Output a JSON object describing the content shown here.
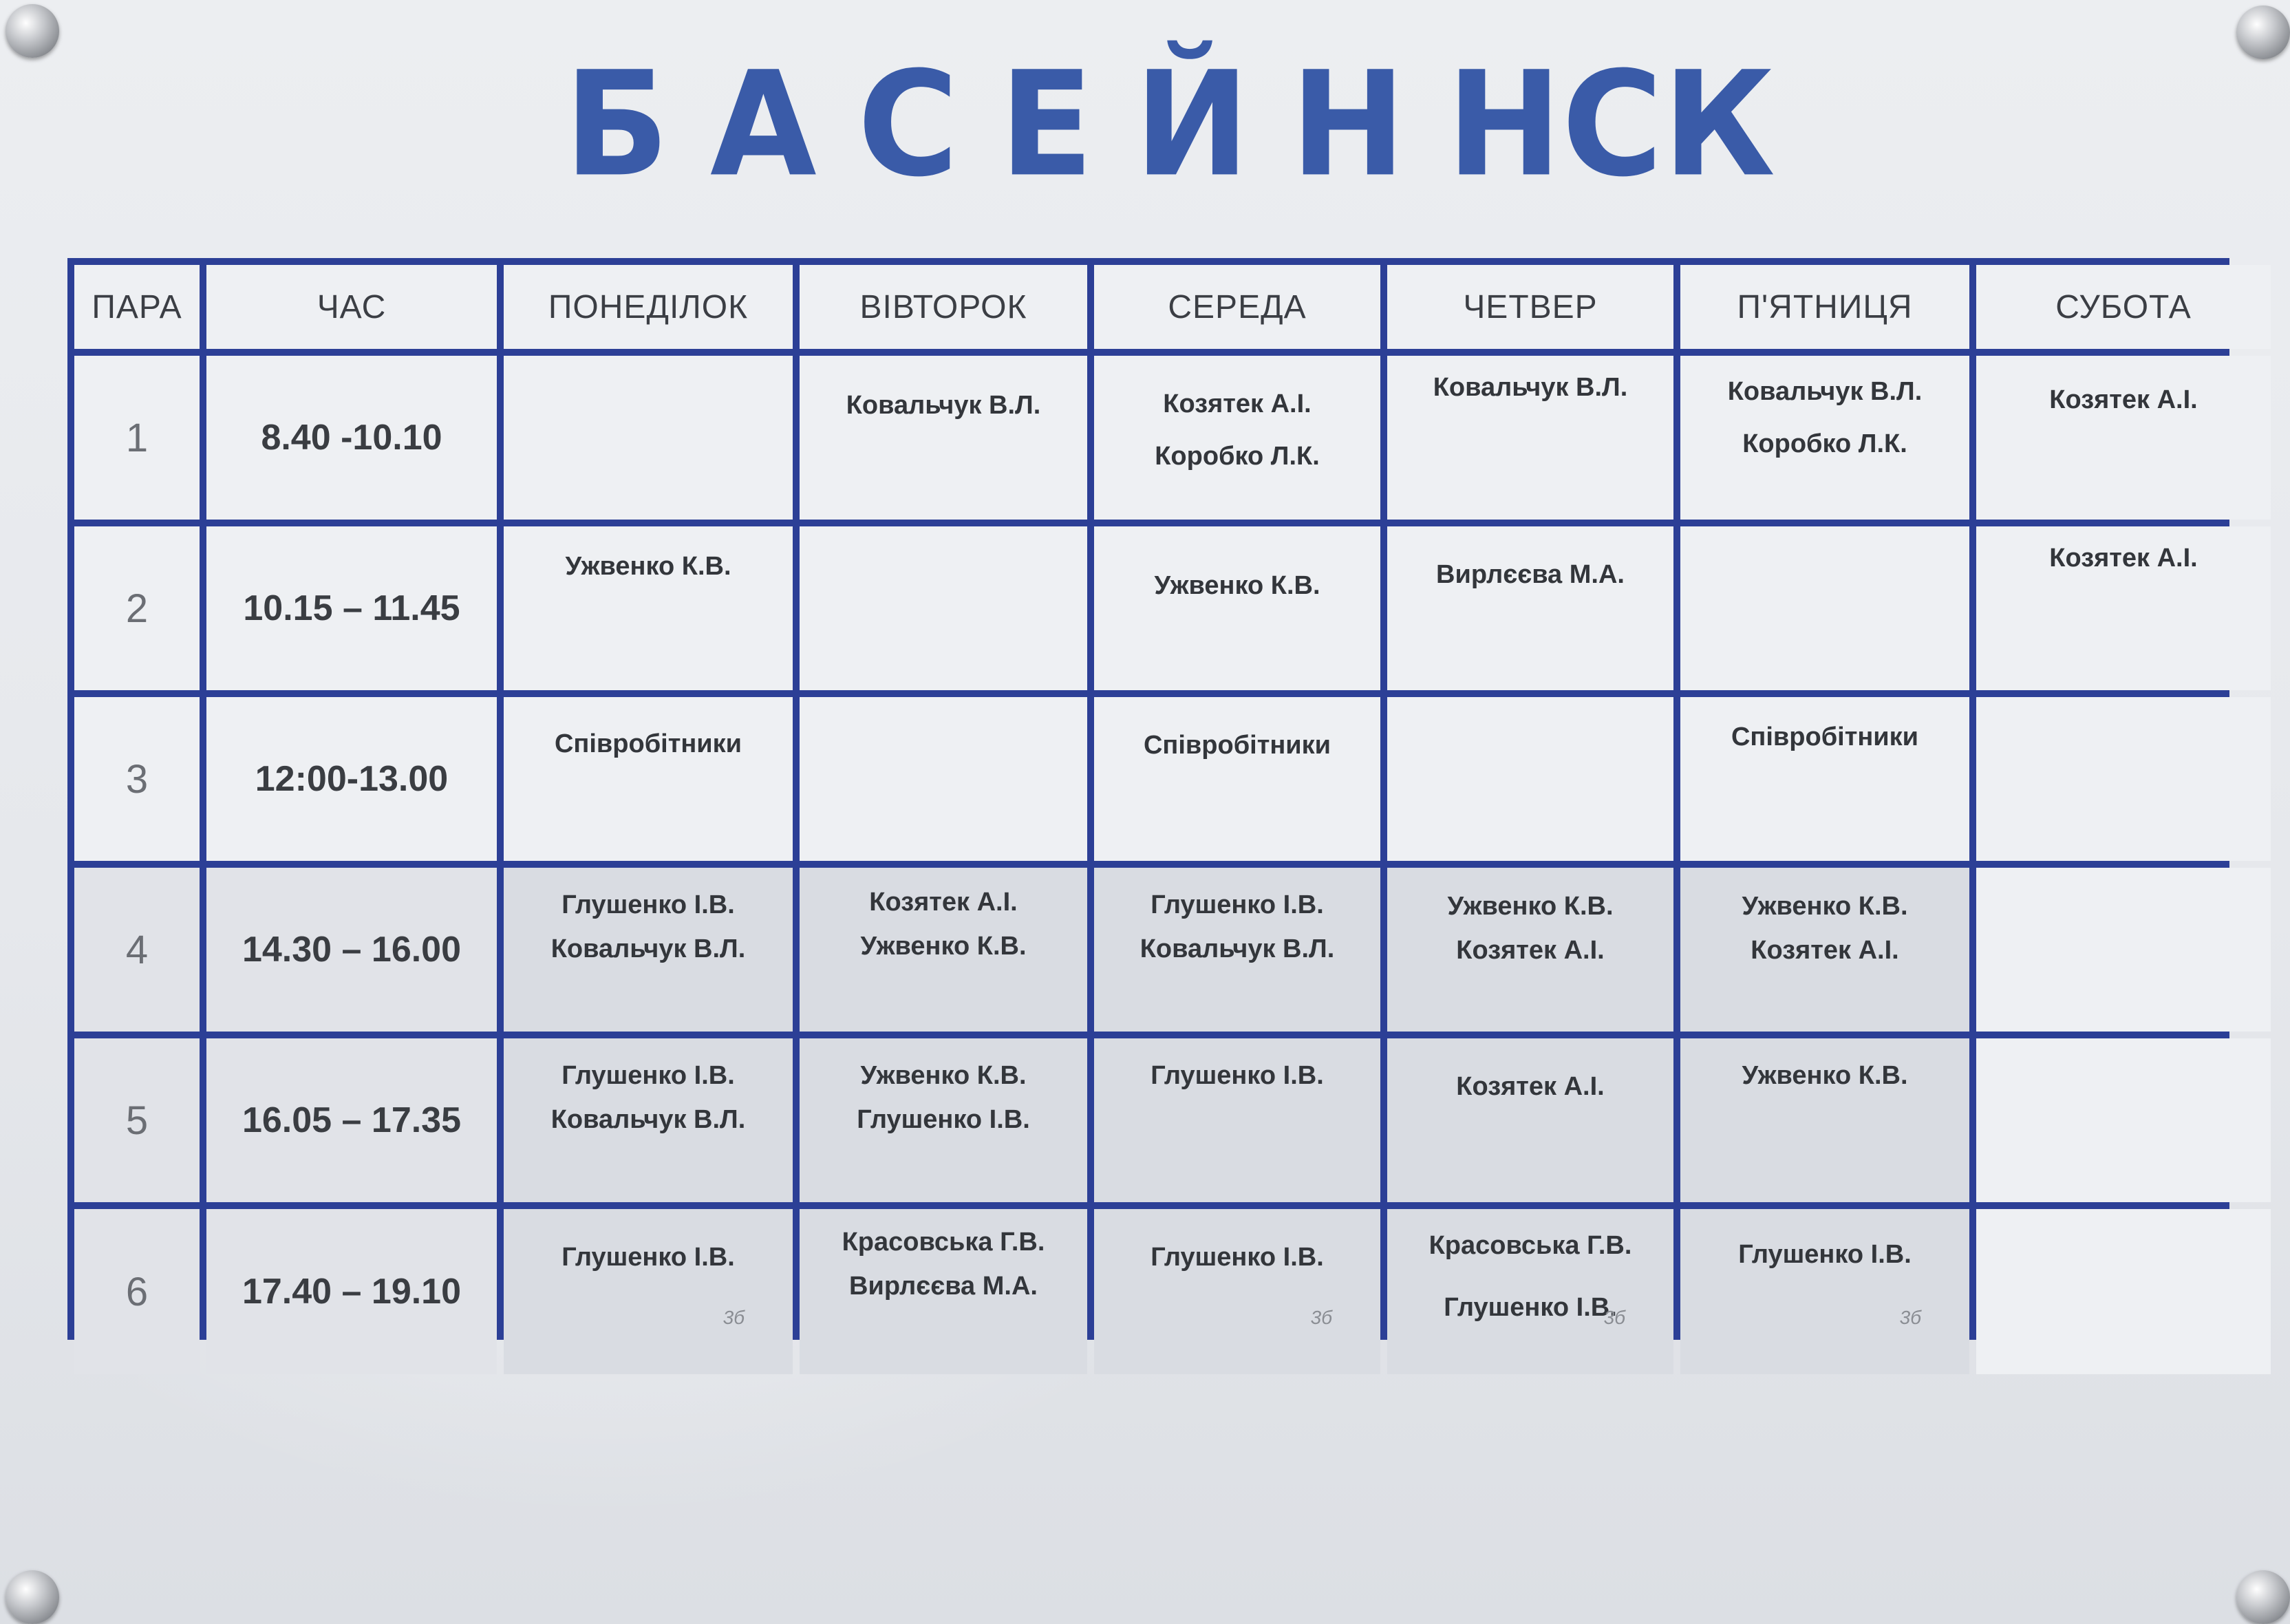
{
  "title_letters": [
    "Б",
    "А",
    "С",
    "Е",
    "Й",
    "Н",
    "НСК"
  ],
  "headers": [
    "ПАРА",
    "ЧАС",
    "ПОНЕДІЛОК",
    "ВІВТОРОК",
    "СЕРЕДА",
    "ЧЕТВЕР",
    "П'ЯТНИЦЯ",
    "СУБОТА"
  ],
  "rows": [
    {
      "num": "1",
      "time": "8.40 -10.10",
      "cells": [
        [],
        [
          "Ковальчук В.Л."
        ],
        [
          "Козятек А.І.",
          "Коробко Л.К."
        ],
        [
          "Ковальчук В.Л."
        ],
        [
          "Ковальчук В.Л.",
          "Коробко Л.К."
        ],
        [
          "Козятек А.І."
        ]
      ]
    },
    {
      "num": "2",
      "time": "10.15 – 11.45",
      "cells": [
        [
          "Ужвенко К.В."
        ],
        [],
        [
          "Ужвенко К.В."
        ],
        [
          "Вирлєєва М.А."
        ],
        [],
        [
          "Козятек А.І."
        ]
      ]
    },
    {
      "num": "3",
      "time": "12:00-13.00",
      "cells": [
        [
          "Співробітники"
        ],
        [],
        [
          "Співробітники"
        ],
        [],
        [
          "Співробітники"
        ],
        []
      ]
    },
    {
      "num": "4",
      "time": "14.30 – 16.00",
      "cells": [
        [
          "Глушенко І.В.",
          "Ковальчук В.Л."
        ],
        [
          "Козятек А.І.",
          "Ужвенко К.В."
        ],
        [
          "Глушенко І.В.",
          "Ковальчук В.Л."
        ],
        [
          "Ужвенко К.В.",
          "Козятек А.І."
        ],
        [
          "Ужвенко К.В.",
          "Козятек А.І."
        ],
        []
      ]
    },
    {
      "num": "5",
      "time": "16.05 – 17.35",
      "cells": [
        [
          "Глушенко І.В.",
          "Ковальчук В.Л."
        ],
        [
          "Ужвенко К.В.",
          "Глушенко І.В."
        ],
        [
          "Глушенко І.В."
        ],
        [
          "Козятек А.І."
        ],
        [
          "Ужвенко К.В."
        ],
        []
      ]
    },
    {
      "num": "6",
      "time": "17.40 – 19.10",
      "cells": [
        [
          "Глушенко І.В."
        ],
        [
          "Красовська Г.В.",
          "Вирлєєва М.А."
        ],
        [
          "Глушенко І.В."
        ],
        [
          "Красовська Г.В.",
          "Глушенко І.В."
        ],
        [
          "Глушенко І.В."
        ],
        []
      ]
    }
  ],
  "handwritten_note": "3б",
  "colors": {
    "title": "#3a5ba8",
    "grid": "#2c3f96",
    "board": "#eceef1"
  }
}
